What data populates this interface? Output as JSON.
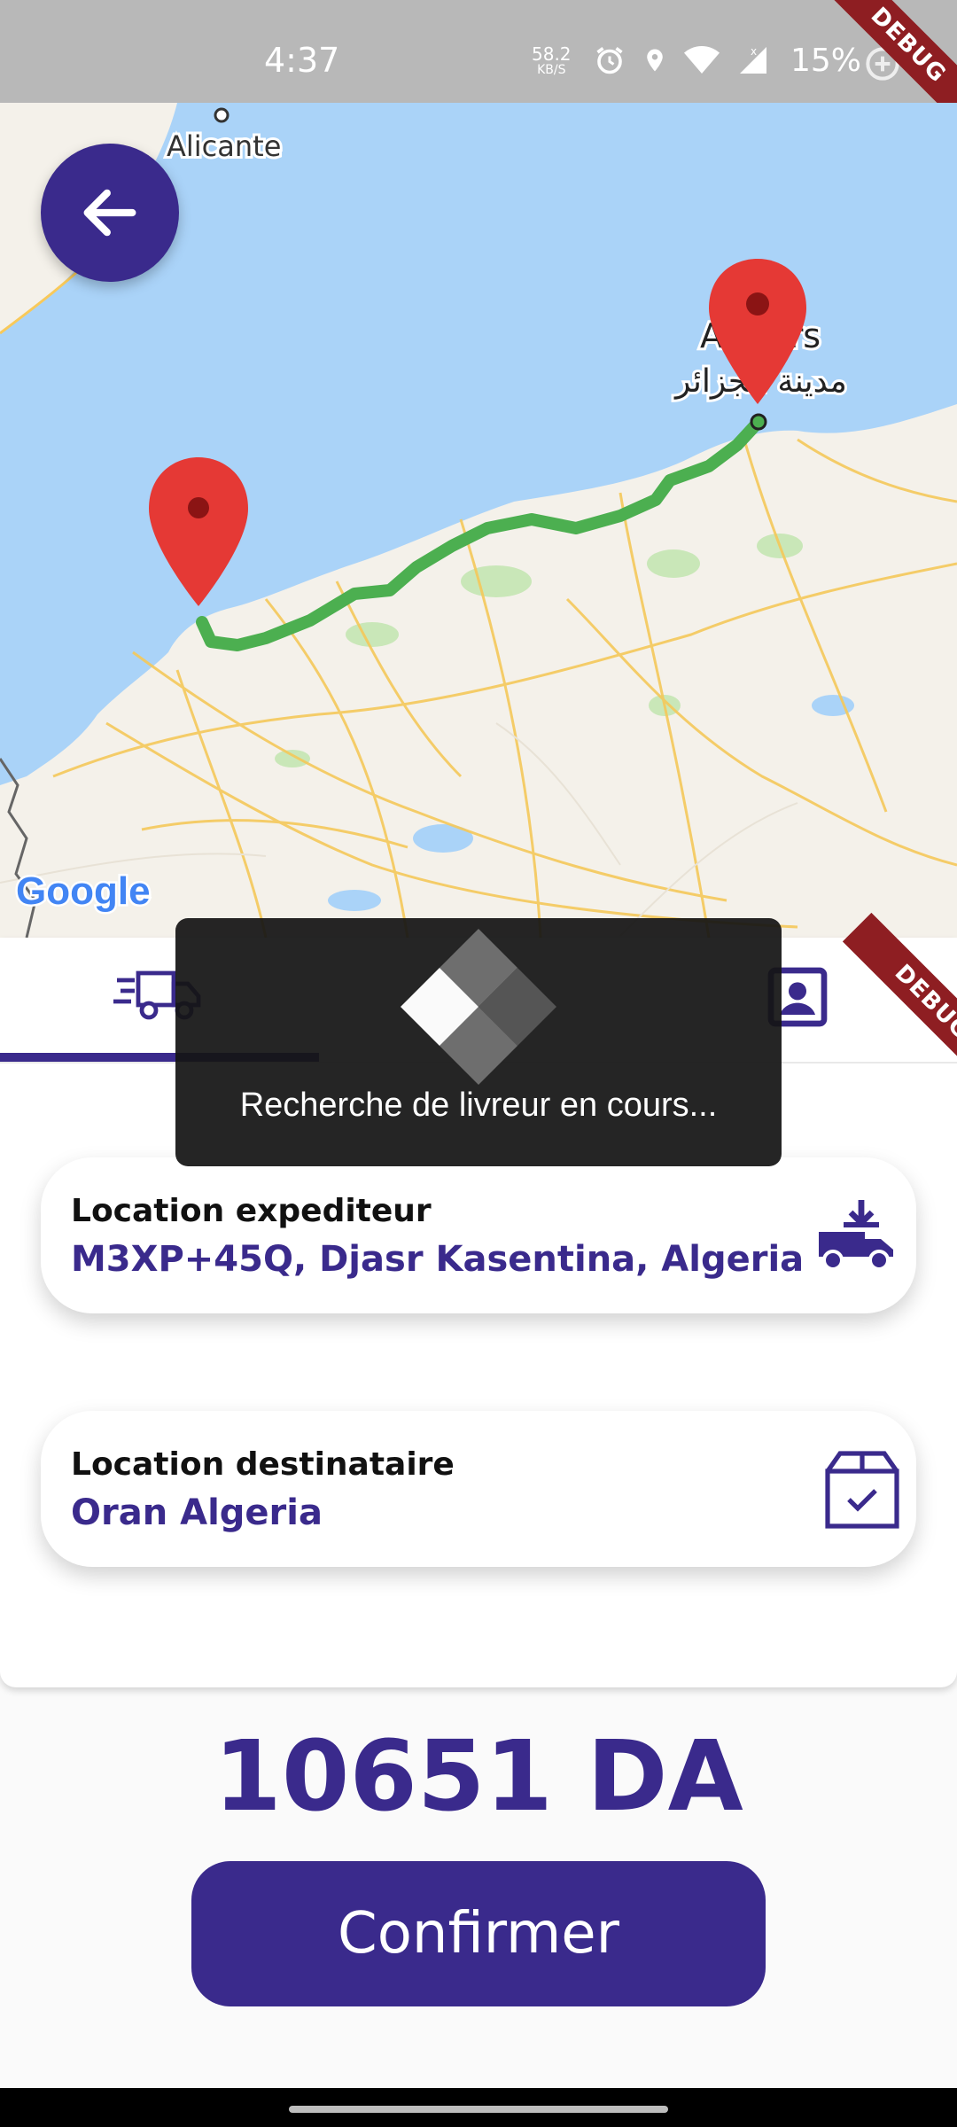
{
  "status_bar": {
    "time": "4:37",
    "speed_value": "58.2",
    "speed_unit": "KB/S",
    "battery": "15%"
  },
  "debug_label": "DEBUG",
  "map": {
    "city_top": "Alicante",
    "city_right_latin": "Alg",
    "city_right_latin_end": "rs",
    "city_right_arabic": "مدينة الجزائر",
    "google_logo": "Google",
    "route_color": "#4caf50",
    "marker_color": "#e53935"
  },
  "colors": {
    "primary": "#3a2a8c"
  },
  "tabs": [
    {
      "name": "delivery",
      "icon": "fast-truck-icon",
      "active": true
    },
    {
      "name": "contact",
      "icon": "contact-card-icon",
      "active": false
    }
  ],
  "sender": {
    "label": "Location expediteur",
    "value": "M3XP+45Q, Djasr Kasentina, Algeria",
    "icon": "truck-download-icon"
  },
  "recipient": {
    "label": "Location destinataire",
    "value": "Oran Algeria",
    "icon": "box-check-icon"
  },
  "price": "10651 DA",
  "confirm_label": "Confirmer",
  "overlay": {
    "message": "Recherche de livreur en cours..."
  }
}
